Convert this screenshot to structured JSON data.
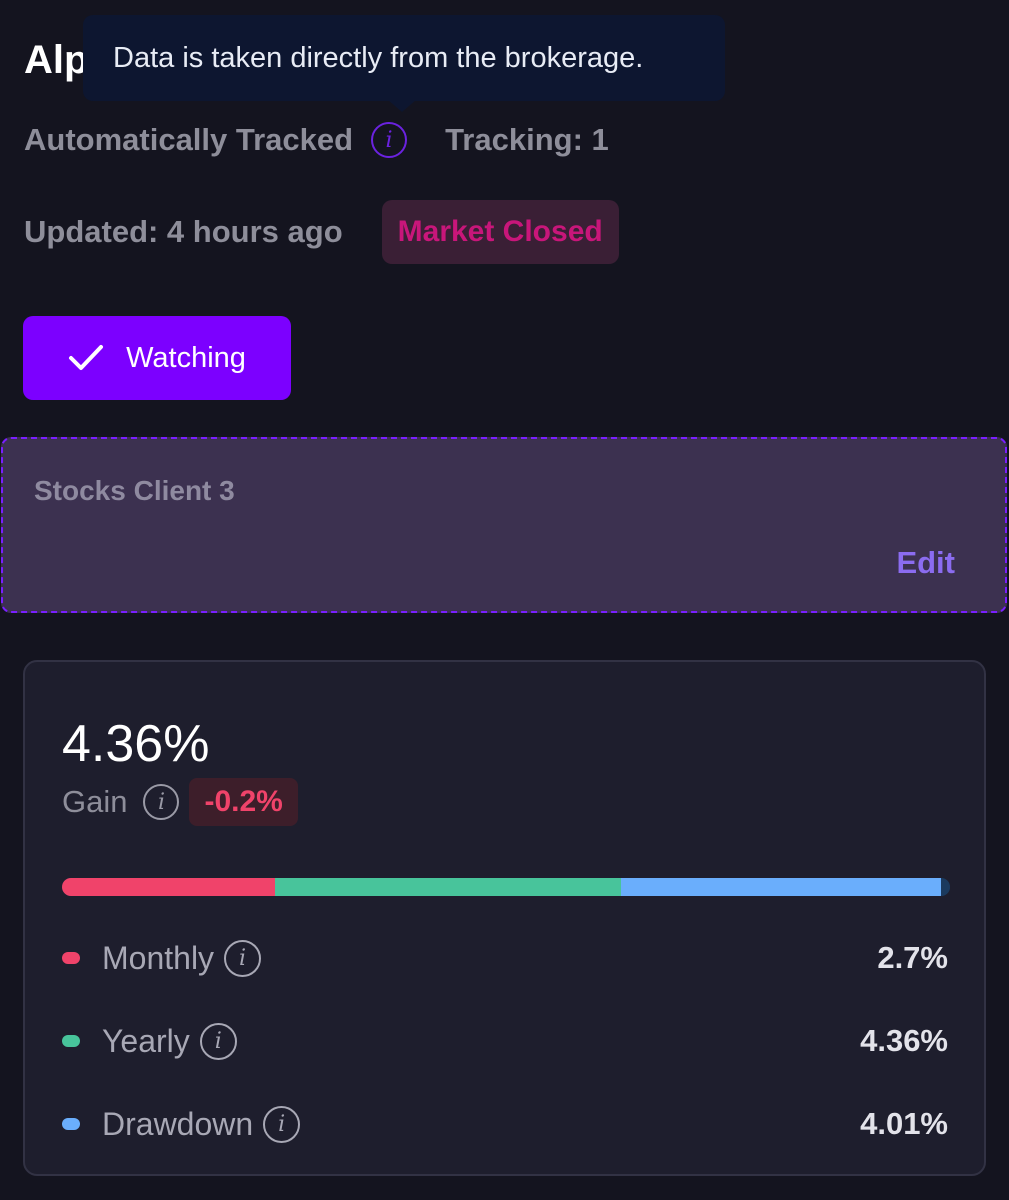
{
  "header": {
    "title": "Alp",
    "tooltip": "Data is taken directly from the brokerage.",
    "tracked_label": "Automatically Tracked",
    "tracking_label": "Tracking: 1",
    "updated_label": "Updated: 4 hours ago",
    "market_status": "Market Closed"
  },
  "watch_button": {
    "label": "Watching",
    "icon": "check-icon"
  },
  "note": {
    "text": "Stocks Client 3",
    "edit_label": "Edit"
  },
  "stats": {
    "gain_value": "4.36%",
    "gain_label": "Gain",
    "gain_change": "-0.2%",
    "bar_fractions": [
      0.24,
      0.39,
      0.36,
      0.01
    ],
    "metrics": [
      {
        "label": "Monthly",
        "value": "2.7%",
        "color": "#f0436a"
      },
      {
        "label": "Yearly",
        "value": "4.36%",
        "color": "#48c49b"
      },
      {
        "label": "Drawdown",
        "value": "4.01%",
        "color": "#6aaefc"
      }
    ]
  },
  "colors": {
    "accent": "#7c00ff",
    "market_closed": "#c8167a",
    "negative": "#f0436a",
    "monthly": "#f0436a",
    "yearly": "#48c49b",
    "drawdown": "#6aaefc",
    "bar_tail": "#1b3a5e"
  }
}
